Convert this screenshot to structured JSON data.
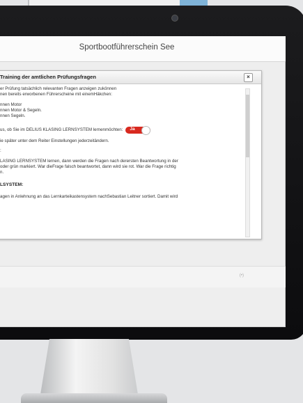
{
  "app": {
    "title": "Sportbootführerschein See"
  },
  "dialog": {
    "title": "Training der amtlichen Prüfungsfragen",
    "close_label": "×",
    "lines": [
      "er Prüfung tatsächlich relevanten Fragen anzeigen zukönnen",
      "nen bereits erworbenen Führerscheine mit einemHäkchen:"
    ],
    "options": [
      "nnen Motor",
      "nnen Motor & Segeln.",
      "nnen Segeln."
    ],
    "lernsystem_question": "us, ob Sie im DELIUS KLASING LERNSYSTEM lernenmöchten:",
    "toggle_label": "Ja",
    "settings_hint": "ie später unter dem Reiter Einstellungen jederzeitändern.",
    "colon_line": ":",
    "paragraph_lines": [
      "LASING LERNSYSTEM lernen, dann werden die Fragen nach derersten Beantwortung in der",
      "oder grün markiert. War dieFrage falsch beantwortet, dann wird sie rot. War die Frage richtig",
      "n."
    ],
    "section_heading": "LSYSTEM:",
    "section_line": "agen in Anlehnung an das Lernkarteikastensystem nachSebastian Leitner sortiert. Damit wird"
  },
  "footer": {
    "label": "(•)"
  }
}
